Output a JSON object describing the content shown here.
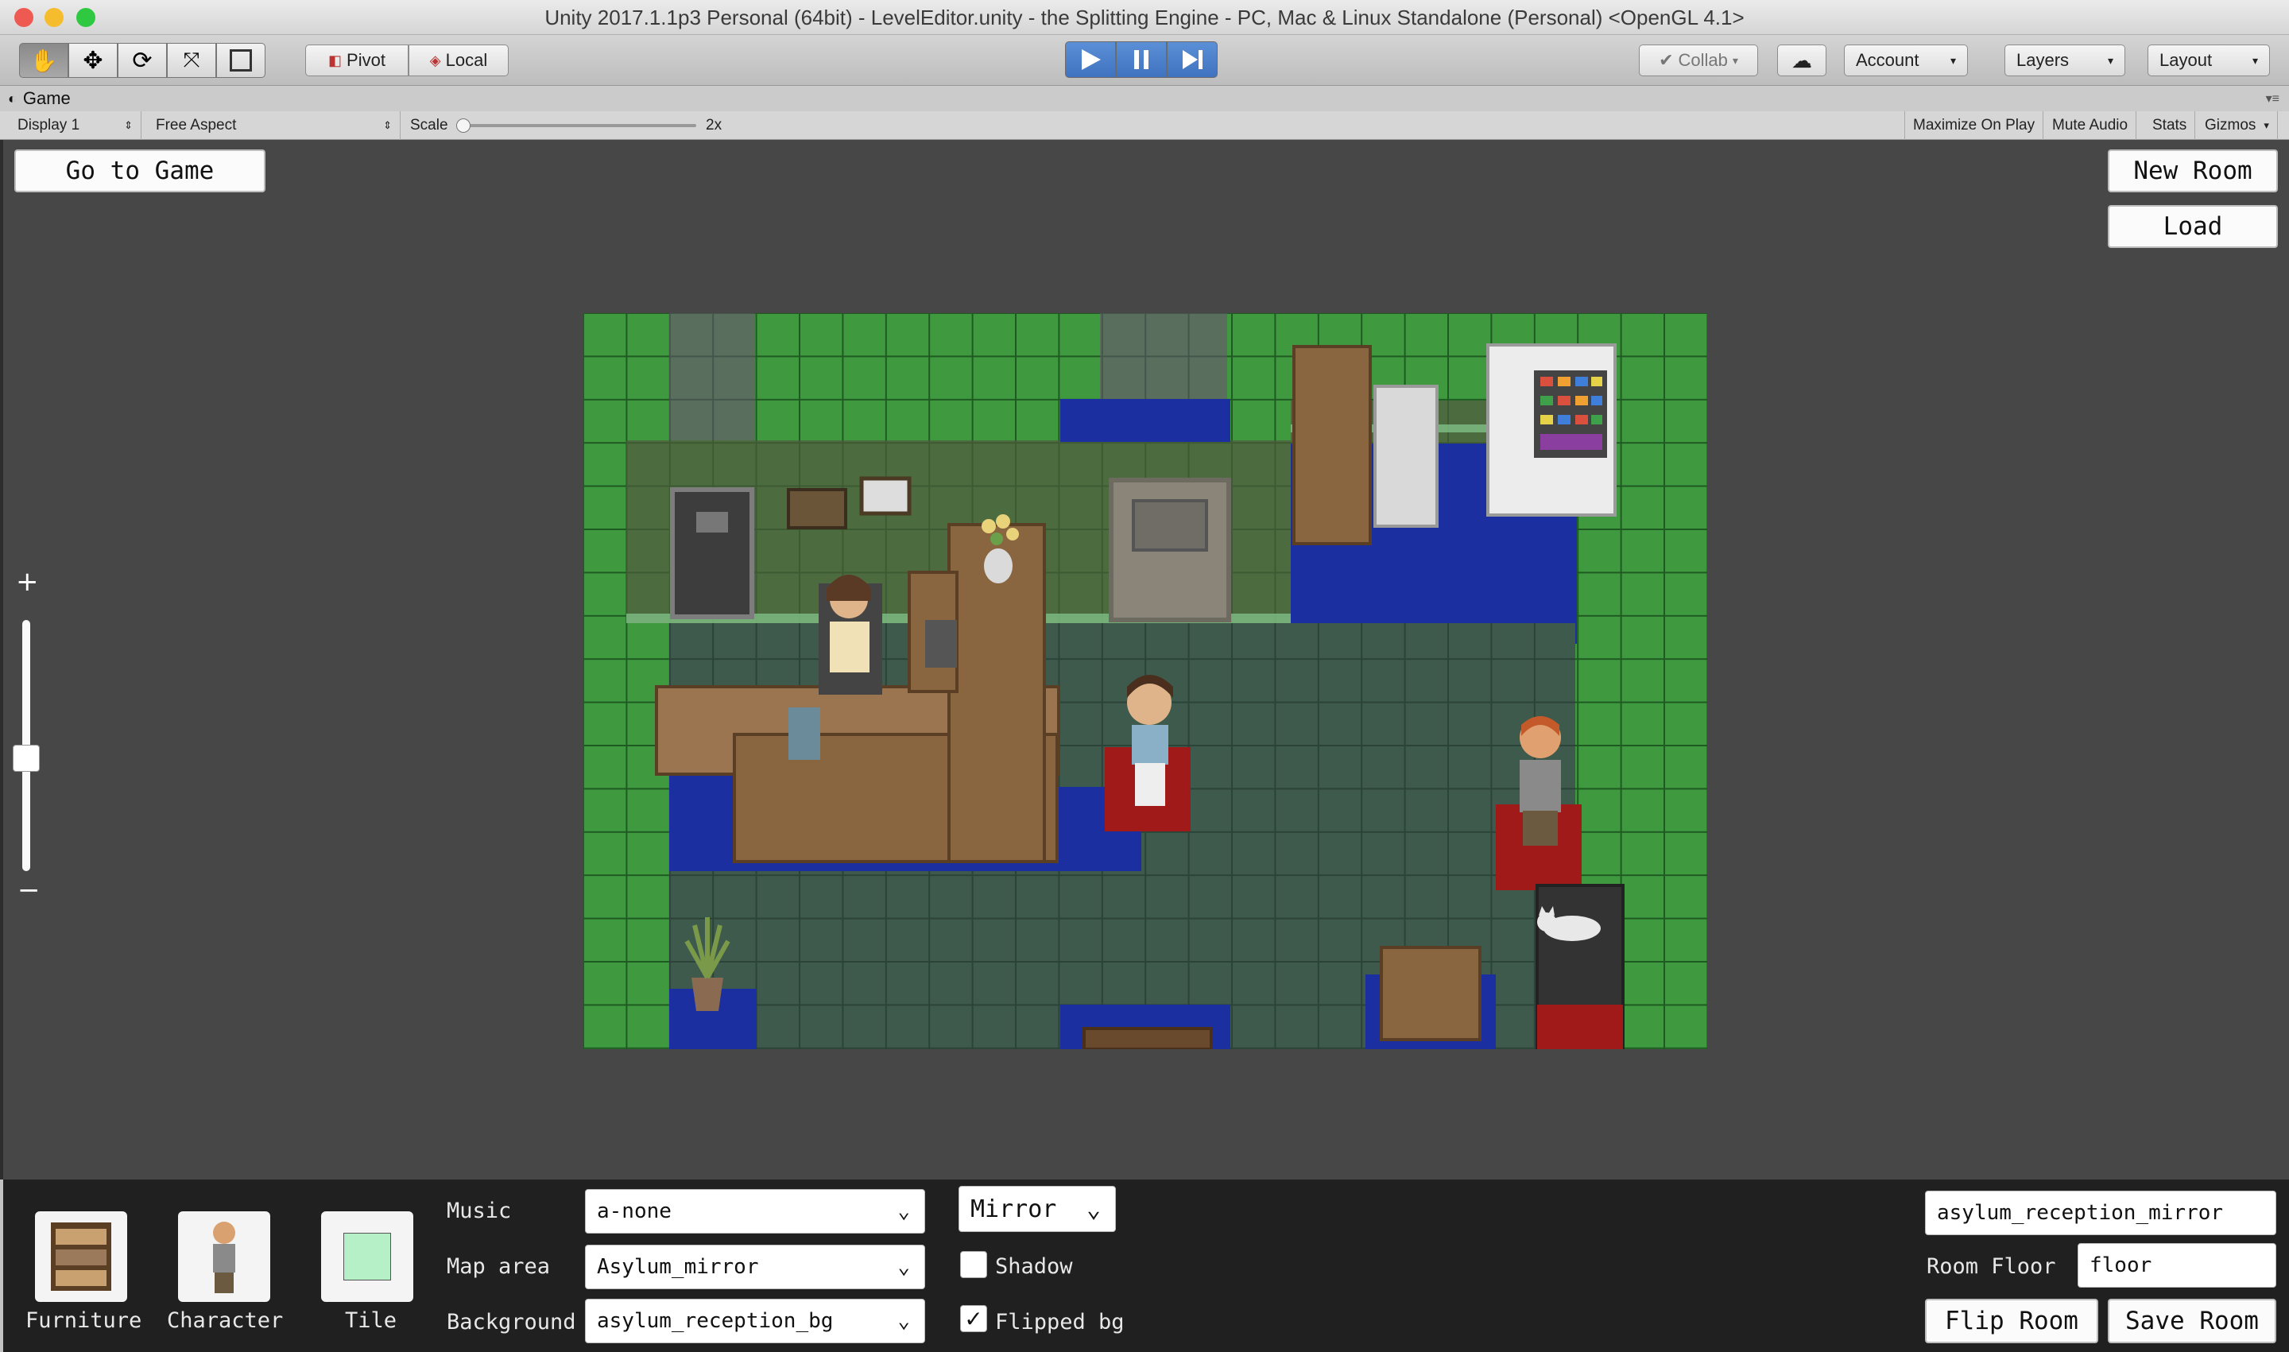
{
  "window": {
    "title": "Unity 2017.1.1p3 Personal (64bit) - LevelEditor.unity - the Splitting Engine - PC, Mac & Linux Standalone (Personal) <OpenGL 4.1>"
  },
  "toolbar": {
    "tools": [
      "hand-icon",
      "move-icon",
      "rotate-icon",
      "scale-icon",
      "rect-icon"
    ],
    "pivot": "Pivot",
    "local": "Local",
    "collab": "Collab",
    "account": "Account",
    "layers": "Layers",
    "layout": "Layout"
  },
  "game_tab": {
    "label": "Game"
  },
  "gamebar": {
    "display": "Display 1",
    "aspect": "Free Aspect",
    "scale_label": "Scale",
    "scale_value": "2x",
    "maximize": "Maximize On Play",
    "mute": "Mute Audio",
    "stats": "Stats",
    "gizmos": "Gizmos"
  },
  "editor": {
    "go_to_game": "Go to Game",
    "new_room": "New Room",
    "load": "Load",
    "zoom_plus": "+",
    "zoom_minus": "−",
    "zoom_level": 0.45
  },
  "palette": {
    "furniture": "Furniture",
    "character": "Character",
    "tile": "Tile",
    "tile_color": "#b6f0c7"
  },
  "settings": {
    "music_label": "Music",
    "music_value": "a-none",
    "map_area_label": "Map area",
    "map_area_value": "Asylum_mirror",
    "background_label": "Background",
    "background_value": "asylum_reception_bg",
    "mirror_value": "Mirror",
    "shadow_label": "Shadow",
    "shadow_checked": false,
    "flipped_label": "Flipped bg",
    "flipped_checked": true
  },
  "room": {
    "name_value": "asylum_reception_mirror",
    "floor_label": "Room Floor",
    "floor_value": "floor",
    "flip_room": "Flip Room",
    "save_room": "Save Room"
  },
  "colors": {
    "grass": "#3f9a3f",
    "floor": "#3d5a4c",
    "rug_blue": "#1b2fa0",
    "rug_red": "#a11a1a",
    "wood": "#8a6640",
    "wall": "#4c6b3e",
    "accent_play": "#3f73c0"
  }
}
